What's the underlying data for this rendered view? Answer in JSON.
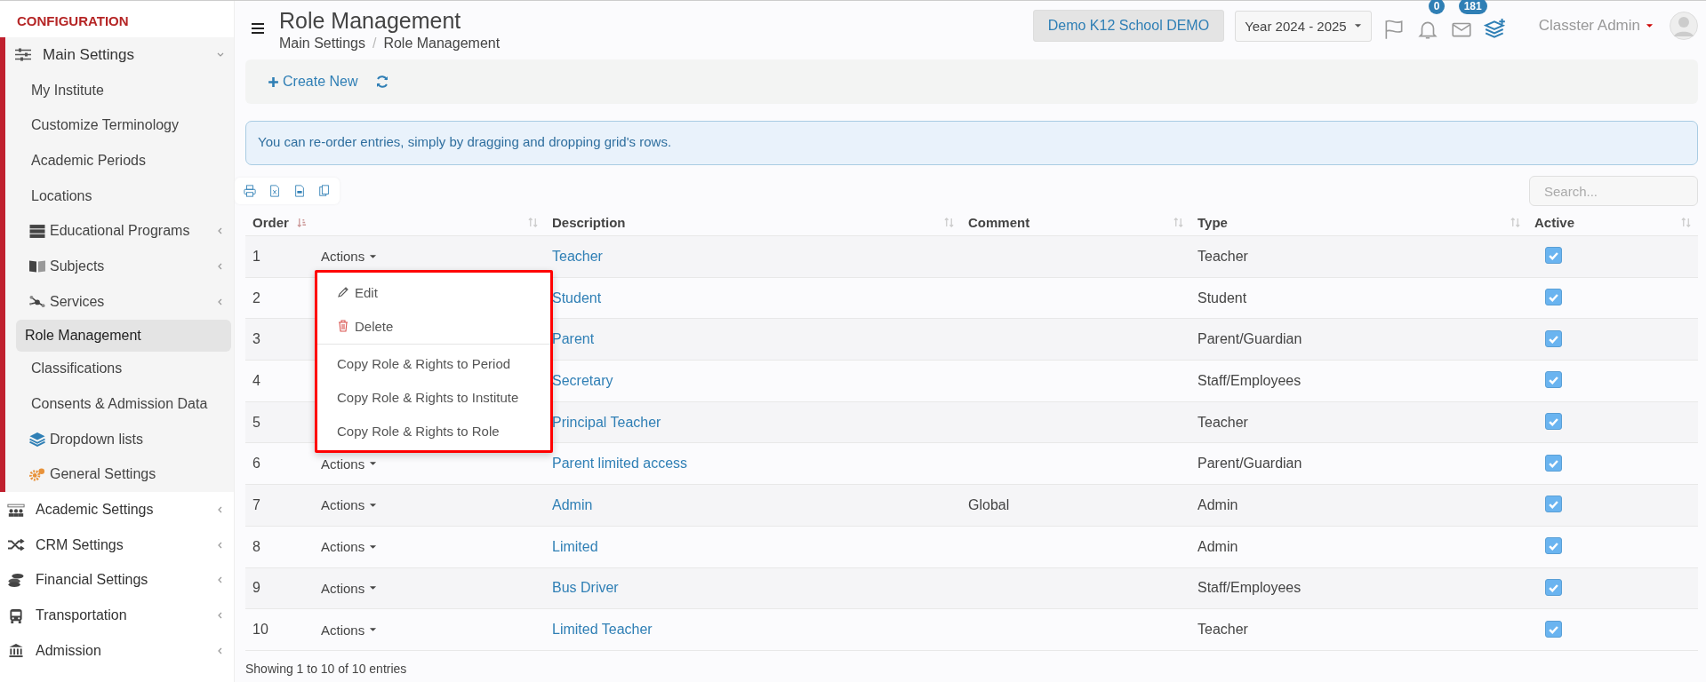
{
  "sidebar": {
    "heading": "CONFIGURATION",
    "items": [
      {
        "label": "Main Settings",
        "expanded": true,
        "selected": false,
        "children": [
          {
            "label": "My Institute",
            "selected": false
          },
          {
            "label": "Customize Terminology",
            "selected": false
          },
          {
            "label": "Academic Periods",
            "selected": false
          },
          {
            "label": "Locations",
            "selected": false
          },
          {
            "label": "Educational Programs",
            "selected": false,
            "expanded": false
          },
          {
            "label": "Subjects",
            "selected": false,
            "expanded": false
          },
          {
            "label": "Services",
            "selected": false,
            "expanded": false
          },
          {
            "label": "Role Management",
            "selected": true
          },
          {
            "label": "Classifications",
            "selected": false
          },
          {
            "label": "Consents & Admission Data",
            "selected": false
          },
          {
            "label": "Dropdown lists",
            "selected": false
          },
          {
            "label": "General Settings",
            "selected": false
          }
        ]
      },
      {
        "label": "Academic Settings",
        "expanded": false,
        "selected": false
      },
      {
        "label": "CRM Settings",
        "expanded": false,
        "selected": false
      },
      {
        "label": "Financial Settings",
        "expanded": false,
        "selected": false
      },
      {
        "label": "Transportation",
        "expanded": false,
        "selected": false
      },
      {
        "label": "Admission",
        "expanded": false,
        "selected": false
      }
    ]
  },
  "header": {
    "title": "Role Management",
    "breadcrumb": [
      "Main Settings",
      "Role Management"
    ],
    "breadcrumb_separator": "/",
    "school": "Demo K12 School DEMO",
    "year": "Year 2024 - 2025",
    "notifications": "0",
    "messages": "181",
    "user": "Classter Admin"
  },
  "toolbar": {
    "create": "Create New"
  },
  "alert": "You can re-order entries, simply by dragging and dropping grid's rows.",
  "search": {
    "placeholder": "Search..."
  },
  "table": {
    "columns": [
      "Order",
      "Description",
      "Comment",
      "Type",
      "Active"
    ],
    "rows": [
      {
        "order": "1",
        "actions": "Actions",
        "description": "Teacher",
        "type": "Teacher",
        "active": true
      },
      {
        "order": "2",
        "description": "Student",
        "type": "Student",
        "active": true
      },
      {
        "order": "3",
        "description": "Parent",
        "type": "Parent/Guardian",
        "active": true
      },
      {
        "order": "4",
        "description": "Secretary",
        "type": "Staff/Employees",
        "active": true
      },
      {
        "order": "5",
        "description": "Principal Teacher",
        "type": "Teacher",
        "active": true
      },
      {
        "order": "6",
        "actions": "Actions",
        "description": "Parent limited access",
        "type": "Parent/Guardian",
        "active": true
      },
      {
        "order": "7",
        "actions": "Actions",
        "description": "Admin",
        "comment": "Global",
        "type": "Admin",
        "active": true
      },
      {
        "order": "8",
        "actions": "Actions",
        "description": "Limited",
        "type": "Admin",
        "active": true
      },
      {
        "order": "9",
        "actions": "Actions",
        "description": "Bus Driver",
        "type": "Staff/Employees",
        "active": true
      },
      {
        "order": "10",
        "actions": "Actions",
        "description": "Limited Teacher",
        "type": "Teacher",
        "active": true
      }
    ]
  },
  "menu": {
    "items": [
      {
        "label": "Edit",
        "kind": "edit"
      },
      {
        "label": "Delete",
        "kind": "delete"
      },
      {
        "label": "Copy Role & Rights to Period",
        "kind": "plain"
      },
      {
        "label": "Copy Role & Rights to Institute",
        "kind": "plain"
      },
      {
        "label": "Copy Role & Rights to Role",
        "kind": "plain"
      }
    ]
  },
  "footer": "Showing 1 to 10 of 10 entries"
}
